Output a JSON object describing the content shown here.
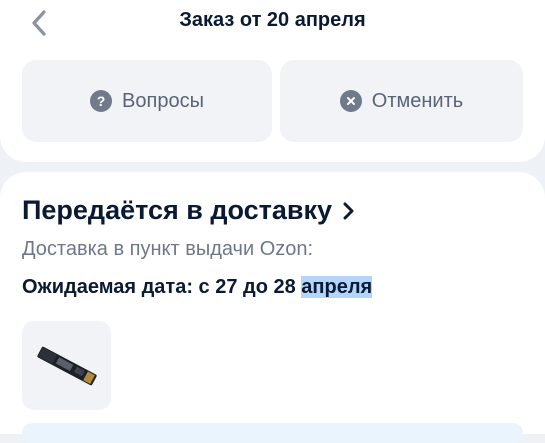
{
  "header": {
    "title": "Заказ от 20 апреля",
    "back_icon": "chevron-left-icon"
  },
  "actions": {
    "questions_label": "Вопросы",
    "questions_icon": "question-circle-icon",
    "cancel_label": "Отменить",
    "cancel_icon": "close-circle-icon"
  },
  "shipment": {
    "status": "Передаётся в доставку",
    "delivery_type": "Доставка в пункт выдачи Ozon:",
    "expected_prefix": "Ожидаемая дата: с 27 до 28 ",
    "expected_highlight": "апреля",
    "product_icon": "ssd-drive-icon"
  },
  "colors": {
    "background": "#eef1f6",
    "text_primary": "#0b1a33",
    "text_secondary": "#6e7888",
    "button_bg": "#f1f3f7",
    "icon_gray": "#707a8a",
    "selection_highlight": "#b3d4fc"
  }
}
